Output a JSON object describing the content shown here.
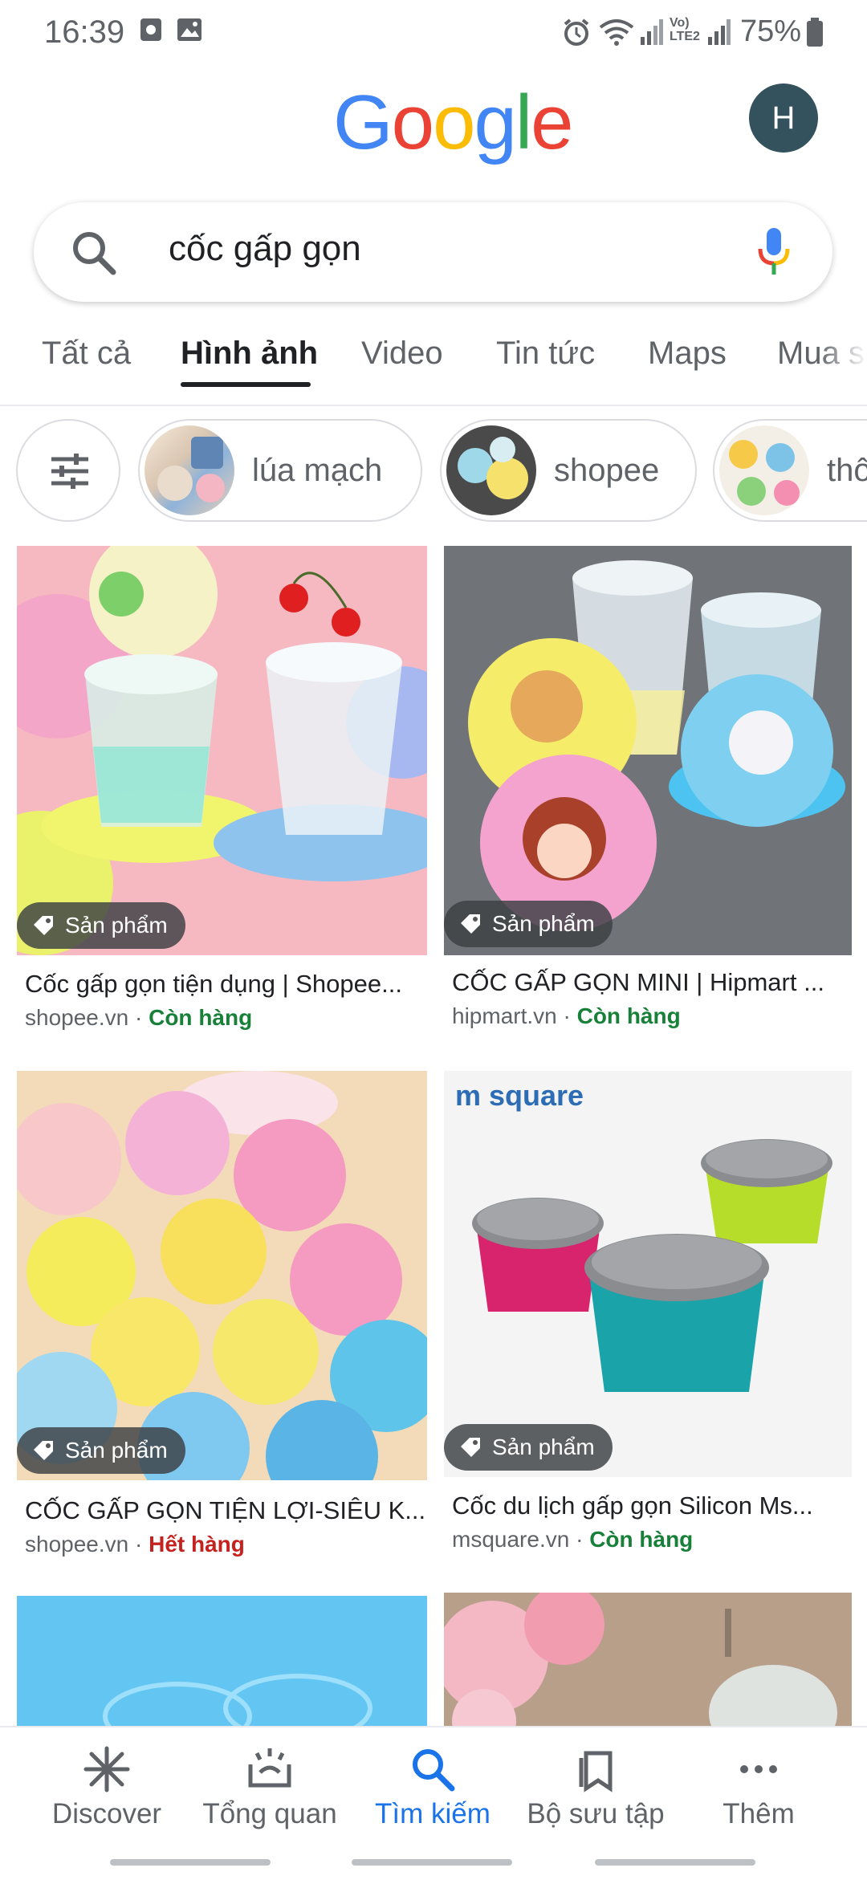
{
  "status_bar": {
    "time": "16:39",
    "battery": "75%",
    "network_label": "Vo) LTE2"
  },
  "header": {
    "logo_text": "Google",
    "avatar_initial": "H"
  },
  "search": {
    "query": "cốc gấp gọn"
  },
  "tabs": [
    {
      "label": "Tất cả"
    },
    {
      "label": "Hình ảnh",
      "active": true
    },
    {
      "label": "Video"
    },
    {
      "label": "Tin tức"
    },
    {
      "label": "Maps"
    },
    {
      "label": "Mua sắm"
    }
  ],
  "chips": [
    {
      "label": "lúa mạch"
    },
    {
      "label": "shopee"
    },
    {
      "label": "thô"
    }
  ],
  "results": [
    {
      "badge": "Sản phẩm",
      "title": "Cốc gấp gọn tiện dụng | Shopee...",
      "source": "shopee.vn",
      "separator": " · ",
      "availability": "Còn hàng"
    },
    {
      "badge": "Sản phẩm",
      "title": "CỐC GẤP GỌN MINI | Hipmart ...",
      "source": "hipmart.vn",
      "separator": " · ",
      "availability": "Còn hàng"
    },
    {
      "badge": "Sản phẩm",
      "title": "CỐC GẤP GỌN TIỆN LỢI-SIÊU K...",
      "source": "shopee.vn",
      "separator": " · ",
      "availability": "Hết hàng"
    },
    {
      "badge": "Sản phẩm",
      "title": "Cốc du lịch gấp gọn Silicon Ms...",
      "source": "msquare.vn",
      "separator": " · ",
      "availability": "Còn hàng",
      "image_text": "m square"
    }
  ],
  "bottom_nav": [
    {
      "label": "Discover",
      "icon": "asterisk-icon"
    },
    {
      "label": "Tổng quan",
      "icon": "overview-icon"
    },
    {
      "label": "Tìm kiếm",
      "icon": "search-icon",
      "active": true
    },
    {
      "label": "Bộ sưu tập",
      "icon": "bookmark-icon"
    },
    {
      "label": "Thêm",
      "icon": "more-icon"
    }
  ],
  "colors": {
    "accent": "#1a73e8",
    "in_stock": "#188038",
    "out_stock": "#c5221f"
  }
}
